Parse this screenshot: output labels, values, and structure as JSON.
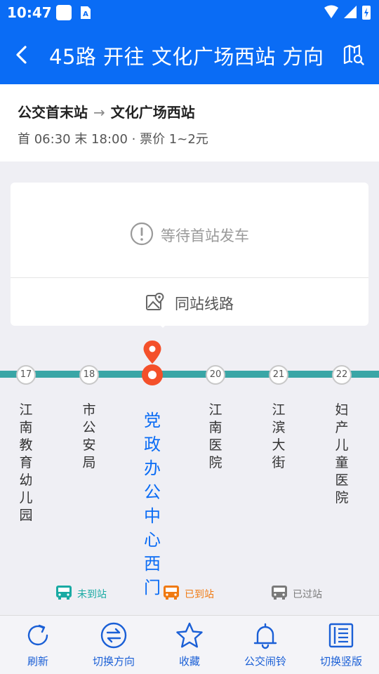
{
  "status_bar": {
    "time": "10:47"
  },
  "header": {
    "title": "45路 开往 文化广场西站 方向"
  },
  "route_info": {
    "from": "公交首末站",
    "arrow": "→",
    "to": "文化广场西站",
    "schedule": "首 06:30 末 18:00 · 票价 1~2元"
  },
  "card": {
    "waiting_text": "等待首站发车",
    "same_station_label": "同站线路"
  },
  "stops": [
    {
      "number": "17",
      "name": "江南教育幼儿园"
    },
    {
      "number": "18",
      "name": "市公安局"
    },
    {
      "number": "",
      "name": "党政办公中心西门",
      "current": true
    },
    {
      "number": "20",
      "name": "江南医院"
    },
    {
      "number": "21",
      "name": "江滨大街"
    },
    {
      "number": "22",
      "name": "妇产儿童医院"
    }
  ],
  "legend": {
    "not_arrived": "未到站",
    "arrived": "已到站",
    "passed": "已过站"
  },
  "bottom_nav": [
    {
      "label": "刷新",
      "icon": "refresh-icon"
    },
    {
      "label": "切换方向",
      "icon": "switch-direction-icon"
    },
    {
      "label": "收藏",
      "icon": "star-icon"
    },
    {
      "label": "公交闹铃",
      "icon": "bell-icon"
    },
    {
      "label": "切换竖版",
      "icon": "vertical-layout-icon"
    }
  ],
  "colors": {
    "primary": "#0a6cf5",
    "track": "#3aa6a6",
    "current_stop": "#f4502a",
    "not_arrived": "#19aaa3",
    "arrived": "#f07a12",
    "passed": "#7a7a7a"
  }
}
